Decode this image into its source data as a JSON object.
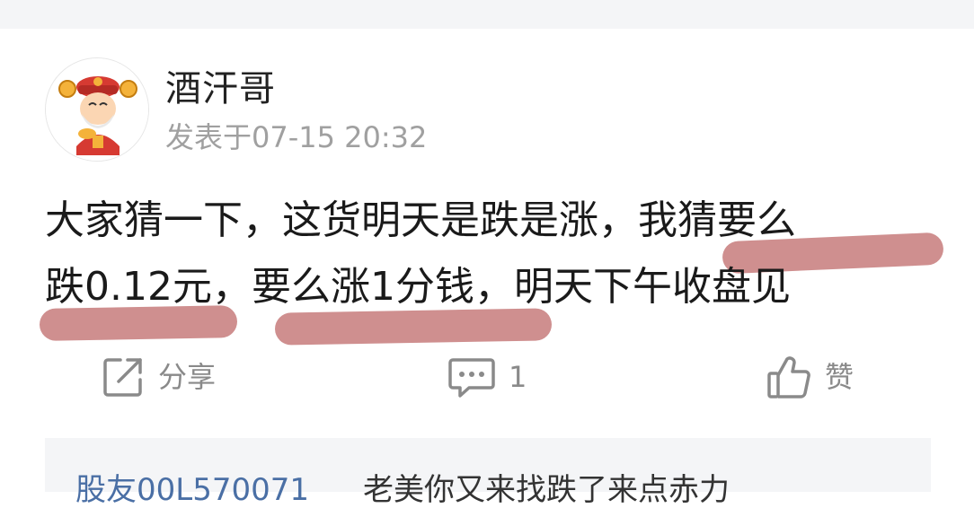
{
  "post": {
    "author": "酒汗哥",
    "time": "发表于07-15 20:32",
    "lines": [
      "大家猜一下，这货明天是跌是涨，我猜要么",
      "跌0.12元，要么涨1分钱，明天下午收盘见"
    ]
  },
  "actions": {
    "share_label": "分享",
    "comment_count": "1",
    "like_label": "赞"
  },
  "reply": {
    "user": "股友00L570071",
    "content": "老美你又来找跌了来点赤力"
  },
  "colors": {
    "highlight": "#c87f80",
    "link": "#4a6fa5",
    "muted": "#a0a0a0"
  },
  "icons": [
    "avatar-image",
    "share-icon",
    "comment-icon",
    "like-icon"
  ]
}
